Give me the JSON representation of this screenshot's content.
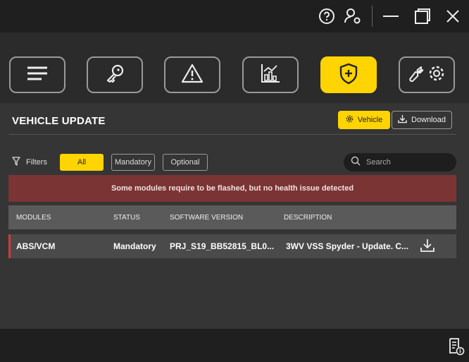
{
  "page": {
    "title": "VEHICLE UPDATE"
  },
  "actions": {
    "vehicle": "Vehicle",
    "download": "Download"
  },
  "filters": {
    "label": "Filters",
    "options": [
      "All",
      "Mandatory",
      "Optional"
    ],
    "selected": "All"
  },
  "search": {
    "placeholder": "Search"
  },
  "banner": {
    "message": "Some modules require to be flashed, but no health issue detected"
  },
  "table": {
    "columns": [
      "MODULES",
      "STATUS",
      "SOFTWARE VERSION",
      "DESCRIPTION"
    ],
    "rows": [
      {
        "module": "ABS/VCM",
        "status": "Mandatory",
        "software_version": "PRJ_S19_BB52815_BL0...",
        "description": "3WV VSS Spyder - Update. C..."
      }
    ]
  },
  "icons": {
    "titlebar": [
      "help-icon",
      "user-settings-icon",
      "minimize-icon",
      "maximize-icon",
      "close-icon"
    ],
    "nav": [
      "menu-icon",
      "key-icon",
      "warning-icon",
      "chart-icon",
      "shield-plus-icon",
      "wrench-gear-icon"
    ],
    "footer": [
      "report-info-icon"
    ]
  },
  "colors": {
    "accent": "#ffd400",
    "banner": "#7a3434",
    "row_marker": "#d23a3a"
  }
}
